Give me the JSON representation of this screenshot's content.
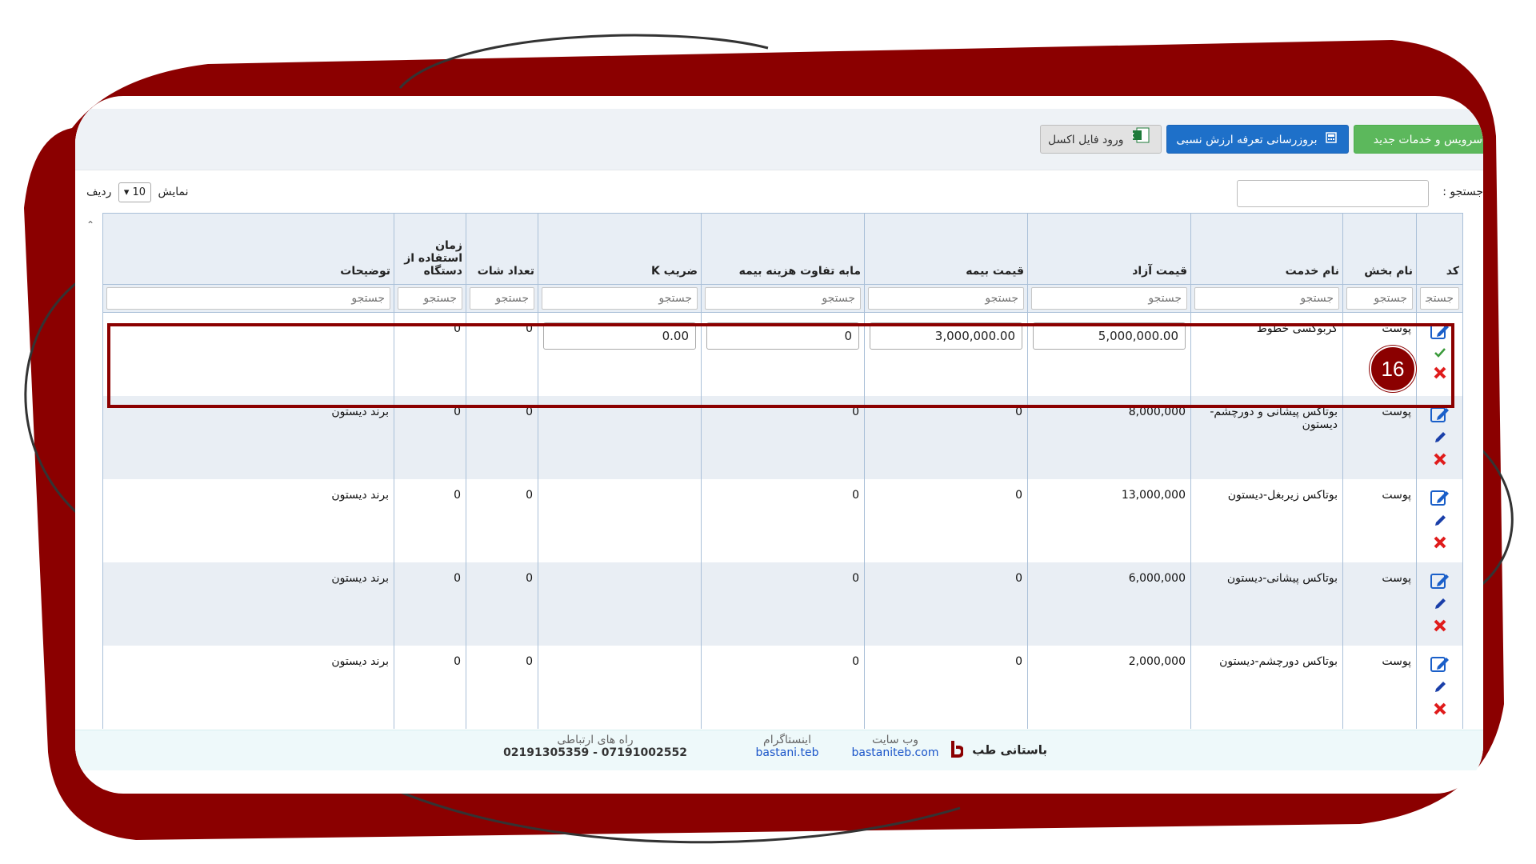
{
  "toolbar": {
    "new_services_label": "سرویس و خدمات جدید",
    "update_tariff_label": "بروزرسانی تعرفه ارزش نسبی",
    "import_excel_label": "ورود فایل اکسل"
  },
  "search": {
    "label": "جستجو :"
  },
  "length": {
    "show": "نمایش",
    "value": "10",
    "rows": "ردیف"
  },
  "columns": [
    "کد",
    "نام بخش",
    "نام خدمت",
    "قیمت آزاد",
    "قیمت بیمه",
    "مابه تفاوت هزینه بیمه",
    "ضریب K",
    "تعداد شات",
    "زمان استفاده از دستگاه",
    "توضیحات"
  ],
  "filter_placeholder": "جستجو",
  "edit_row": {
    "section": "پوست",
    "service": "کربوکسی خطوط",
    "free_price": "5,000,000.00",
    "insurance_price": "3,000,000.00",
    "insurance_diff": "0",
    "k_coef": "0.00",
    "shots": "0",
    "device_time": "0",
    "notes": ""
  },
  "rows": [
    {
      "section": "پوست",
      "service": "بوتاکس پیشانی و دورچشم-دیستون",
      "free_price": "8,000,000",
      "insurance_price": "0",
      "insurance_diff": "0",
      "k_coef": "",
      "shots": "0",
      "device_time": "0",
      "notes": "برند دیستون"
    },
    {
      "section": "پوست",
      "service": "بوتاکس زیربغل-دیستون",
      "free_price": "13,000,000",
      "insurance_price": "0",
      "insurance_diff": "0",
      "k_coef": "",
      "shots": "0",
      "device_time": "0",
      "notes": "برند دیستون"
    },
    {
      "section": "پوست",
      "service": "بوتاکس پیشانی-دیستون",
      "free_price": "6,000,000",
      "insurance_price": "0",
      "insurance_diff": "0",
      "k_coef": "",
      "shots": "0",
      "device_time": "0",
      "notes": "برند دیستون"
    },
    {
      "section": "پوست",
      "service": "بوتاکس دورچشم-دیستون",
      "free_price": "2,000,000",
      "insurance_price": "0",
      "insurance_diff": "0",
      "k_coef": "",
      "shots": "0",
      "device_time": "0",
      "notes": "برند دیستون"
    }
  ],
  "callout_number": "16",
  "footer": {
    "brand": "باستانی طب",
    "website_label": "وب سایت",
    "website_value": "bastaniteb.com",
    "instagram_label": "اینستاگرام",
    "instagram_value": "bastani.teb",
    "contact_label": "راه های ارتباطی",
    "contact_value": "07191002552 - 02191305359"
  },
  "colors": {
    "frame": "#8b0000",
    "green": "#5cb85c",
    "blue": "#1e70c9",
    "header": "#e8eef5"
  }
}
